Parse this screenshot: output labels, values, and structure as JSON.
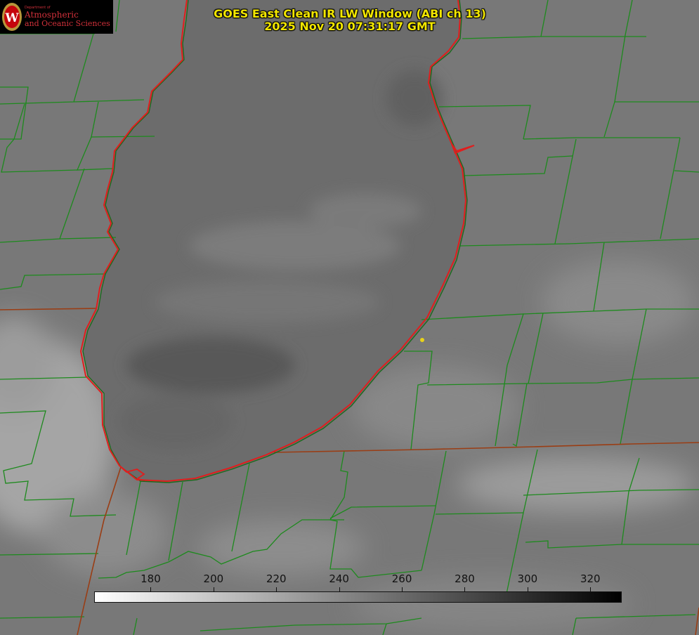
{
  "title": {
    "line1": "GOES East Clean IR LW Window (ABI ch 13)",
    "line2": "2025 Nov 20 07:31:17 GMT"
  },
  "logo": {
    "department": "Department of",
    "line1": "Atmospheric",
    "line2": "and Oceanic Sciences",
    "color": "#d0303a"
  },
  "colorbar": {
    "ticks": [
      "180",
      "200",
      "220",
      "240",
      "260",
      "280",
      "300",
      "320"
    ],
    "range": [
      162,
      330
    ],
    "gradient": [
      "#ffffff",
      "#000000"
    ]
  },
  "colors": {
    "county_lines": "#1d8a1d",
    "state_lines": "#9a3d14",
    "coastline": "#e01e1e",
    "station_marker": "#e8d21a",
    "title_text": "#f2e600"
  }
}
